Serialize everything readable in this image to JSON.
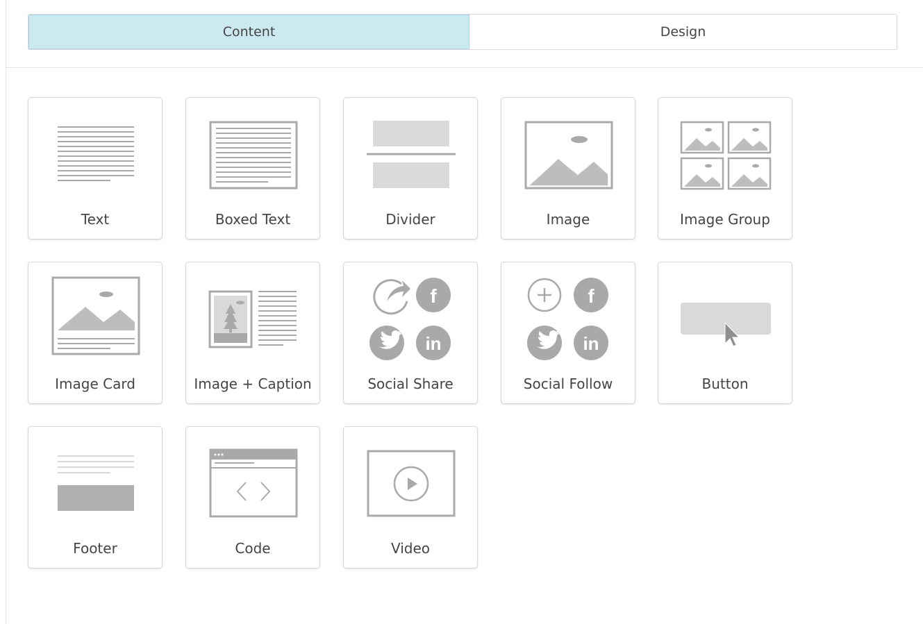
{
  "tabs": [
    {
      "label": "Content",
      "active": true
    },
    {
      "label": "Design",
      "active": false
    }
  ],
  "blocks": [
    {
      "label": "Text",
      "icon": "text-icon"
    },
    {
      "label": "Boxed Text",
      "icon": "boxed-text-icon"
    },
    {
      "label": "Divider",
      "icon": "divider-icon"
    },
    {
      "label": "Image",
      "icon": "image-icon"
    },
    {
      "label": "Image Group",
      "icon": "image-group-icon"
    },
    {
      "label": "Image Card",
      "icon": "image-card-icon"
    },
    {
      "label": "Image + Caption",
      "icon": "image-caption-icon"
    },
    {
      "label": "Social Share",
      "icon": "social-share-icon"
    },
    {
      "label": "Social Follow",
      "icon": "social-follow-icon"
    },
    {
      "label": "Button",
      "icon": "button-icon"
    },
    {
      "label": "Footer",
      "icon": "footer-icon"
    },
    {
      "label": "Code",
      "icon": "code-icon"
    },
    {
      "label": "Video",
      "icon": "video-icon"
    }
  ],
  "colors": {
    "active_tab_bg": "#cce9f1",
    "icon_gray": "#a9a9a9",
    "icon_light": "#d9d9d9"
  }
}
